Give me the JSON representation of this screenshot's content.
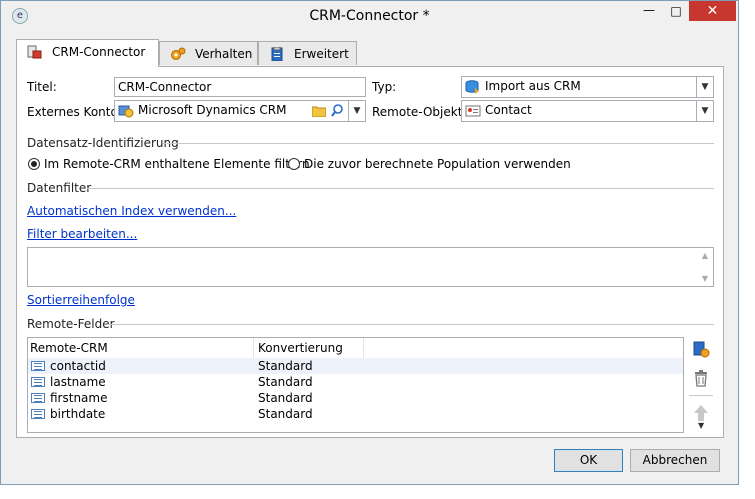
{
  "window": {
    "title": "CRM-Connector *"
  },
  "tabs": [
    {
      "label": "CRM-Connector",
      "icon": "crm-connector-icon"
    },
    {
      "label": "Verhalten",
      "icon": "gears-icon"
    },
    {
      "label": "Erweitert",
      "icon": "clipboard-icon"
    }
  ],
  "form": {
    "titel_label": "Titel:",
    "titel_value": "CRM-Connector",
    "typ_label": "Typ:",
    "typ_value": "Import aus CRM",
    "konto_label": "Externes Konto:",
    "konto_value": "Microsoft Dynamics CRM",
    "remote_label": "Remote-Objekt:",
    "remote_value": "Contact"
  },
  "identification": {
    "heading": "Datensatz-Identifizierung",
    "option1": "Im Remote-CRM enthaltene Elemente filtern",
    "option2": "Die zuvor berechnete Population verwenden",
    "selected": 1
  },
  "filter": {
    "heading": "Datenfilter",
    "auto_index_link": "Automatischen Index verwenden...",
    "edit_filter_link": "Filter bearbeiten...",
    "sort_link": "Sortierreihenfolge"
  },
  "remote_fields": {
    "heading": "Remote-Felder",
    "columns": [
      "Remote-CRM",
      "Konvertierung"
    ],
    "rows": [
      {
        "field": "contactid",
        "conversion": "Standard"
      },
      {
        "field": "lastname",
        "conversion": "Standard"
      },
      {
        "field": "firstname",
        "conversion": "Standard"
      },
      {
        "field": "birthdate",
        "conversion": "Standard"
      }
    ]
  },
  "buttons": {
    "ok": "OK",
    "cancel": "Abbrechen"
  },
  "colors": {
    "link": "#0033cc",
    "close_button": "#c7372f",
    "default_button_border": "#3c7fb1"
  }
}
